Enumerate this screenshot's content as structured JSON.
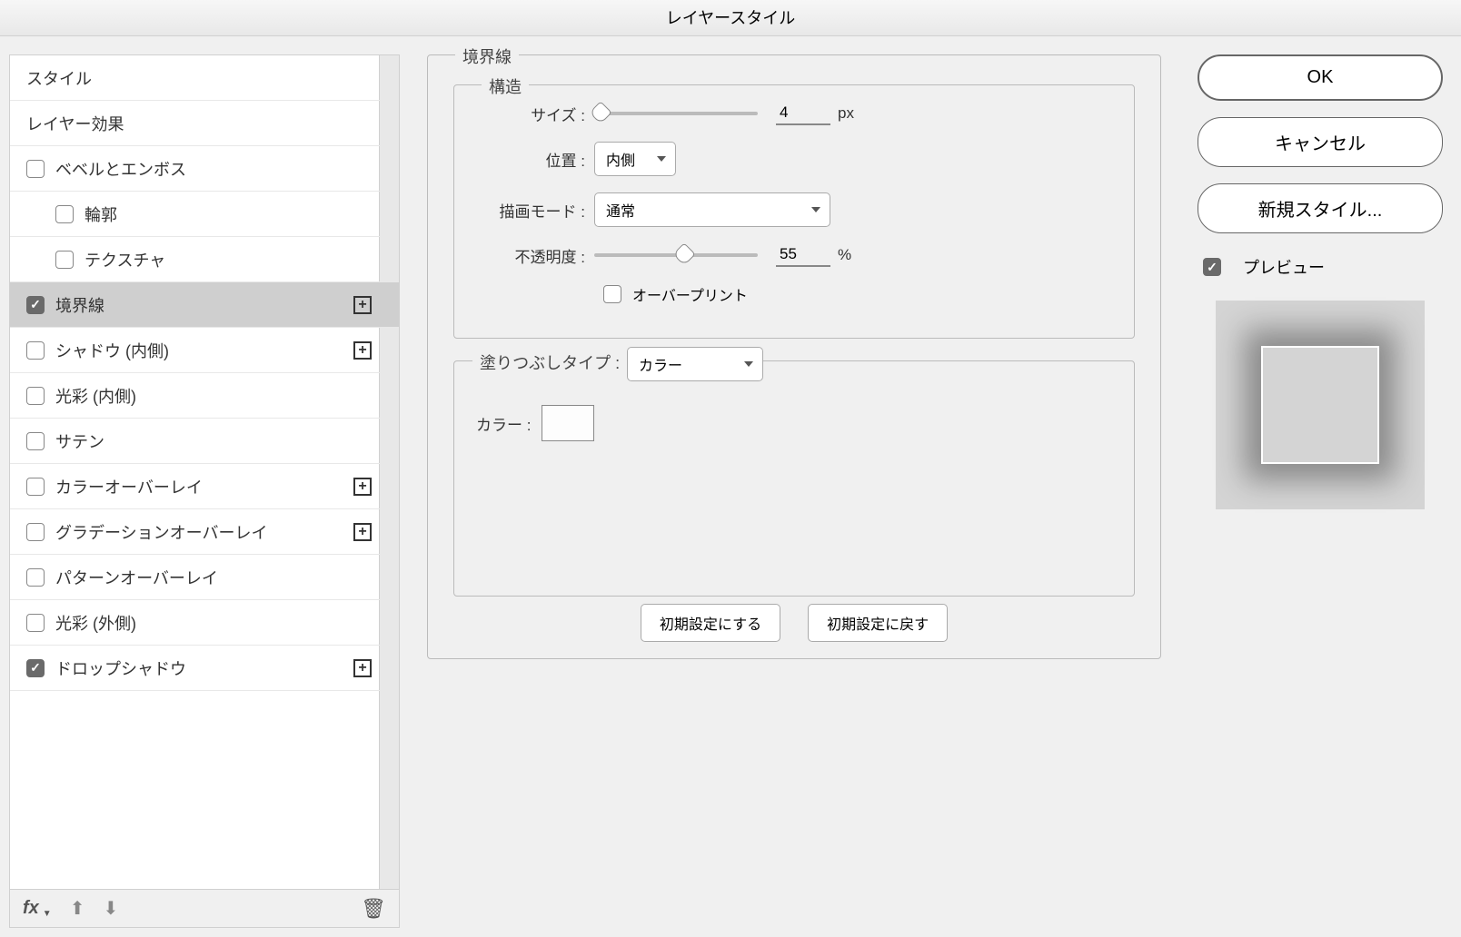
{
  "window": {
    "title": "レイヤースタイル"
  },
  "sidebar": {
    "header_styles": "スタイル",
    "header_effects": "レイヤー効果",
    "items": [
      {
        "label": "ベベルとエンボス",
        "checked": false,
        "plus": false,
        "indent": false
      },
      {
        "label": "輪郭",
        "checked": false,
        "plus": false,
        "indent": true
      },
      {
        "label": "テクスチャ",
        "checked": false,
        "plus": false,
        "indent": true
      },
      {
        "label": "境界線",
        "checked": true,
        "plus": true,
        "indent": false,
        "selected": true
      },
      {
        "label": "シャドウ (内側)",
        "checked": false,
        "plus": true,
        "indent": false
      },
      {
        "label": "光彩 (内側)",
        "checked": false,
        "plus": false,
        "indent": false
      },
      {
        "label": "サテン",
        "checked": false,
        "plus": false,
        "indent": false
      },
      {
        "label": "カラーオーバーレイ",
        "checked": false,
        "plus": true,
        "indent": false
      },
      {
        "label": "グラデーションオーバーレイ",
        "checked": false,
        "plus": true,
        "indent": false
      },
      {
        "label": "パターンオーバーレイ",
        "checked": false,
        "plus": false,
        "indent": false
      },
      {
        "label": "光彩 (外側)",
        "checked": false,
        "plus": false,
        "indent": false
      },
      {
        "label": "ドロップシャドウ",
        "checked": true,
        "plus": true,
        "indent": false
      }
    ],
    "footer_fx": "fx"
  },
  "stroke": {
    "group_label": "境界線",
    "structure_label": "構造",
    "size_label": "サイズ :",
    "size_value": "4",
    "size_unit": "px",
    "position_label": "位置 :",
    "position_value": "内側",
    "blend_label": "描画モード :",
    "blend_value": "通常",
    "opacity_label": "不透明度 :",
    "opacity_value": "55",
    "opacity_unit": "%",
    "overprint_label": "オーバープリント",
    "fill_type_label": "塗りつぶしタイプ :",
    "fill_type_value": "カラー",
    "color_label": "カラー :",
    "make_default": "初期設定にする",
    "reset_default": "初期設定に戻す"
  },
  "right": {
    "ok": "OK",
    "cancel": "キャンセル",
    "new_style": "新規スタイル...",
    "preview_label": "プレビュー"
  }
}
